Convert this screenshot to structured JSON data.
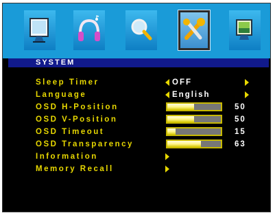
{
  "tabs": [
    {
      "icon": "monitor-icon",
      "active": false
    },
    {
      "icon": "headphones-icon",
      "active": false
    },
    {
      "icon": "magnifier-icon",
      "active": false
    },
    {
      "icon": "tools-icon",
      "active": true
    },
    {
      "icon": "screen-picture-icon",
      "active": false
    }
  ],
  "header": {
    "title": "SYSTEM"
  },
  "menu": {
    "sleep_timer": {
      "label": "Sleep Timer",
      "value": "OFF"
    },
    "language": {
      "label": "Language",
      "value": "English"
    },
    "osd_h_position": {
      "label": "OSD H-Position",
      "value": "50",
      "level": 50
    },
    "osd_v_position": {
      "label": "OSD V-Position",
      "value": "50",
      "level": 50
    },
    "osd_timeout": {
      "label": "OSD Timeout",
      "value": "15",
      "level": 15
    },
    "osd_transparency": {
      "label": "OSD Transparency",
      "value": "63",
      "level": 63
    },
    "information": {
      "label": "Information"
    },
    "memory_recall": {
      "label": "Memory Recall"
    }
  },
  "colors": {
    "label": "#e8d800",
    "header_bg": "#111a8c",
    "tab_bg": "#1a9bd8"
  }
}
